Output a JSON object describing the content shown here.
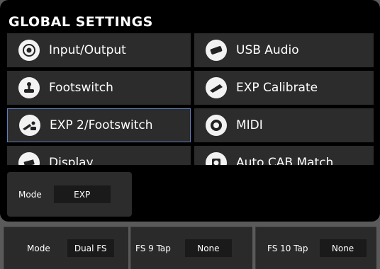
{
  "header": {
    "title": "GLOBAL SETTINGS"
  },
  "menu": {
    "items": [
      {
        "label": "Input/Output",
        "icon": "input-output-icon",
        "active": false
      },
      {
        "label": "USB Audio",
        "icon": "usb-audio-icon",
        "active": false
      },
      {
        "label": "Footswitch",
        "icon": "footswitch-icon",
        "active": false
      },
      {
        "label": "EXP Calibrate",
        "icon": "exp-calibrate-icon",
        "active": false
      },
      {
        "label": "EXP 2/Footswitch",
        "icon": "exp2-footswitch-icon",
        "active": true
      },
      {
        "label": "MIDI",
        "icon": "midi-icon",
        "active": false
      },
      {
        "label": "Display",
        "icon": "display-icon",
        "active": false
      },
      {
        "label": "Auto CAB Match",
        "icon": "auto-cab-icon",
        "active": false
      }
    ]
  },
  "sub": {
    "mode_label": "Mode",
    "mode_value": "EXP"
  },
  "bottom": {
    "cells": [
      {
        "label": "Mode",
        "value": "Dual FS"
      },
      {
        "label": "FS 9 Tap",
        "value": "None"
      },
      {
        "label": "FS 10 Tap",
        "value": "None"
      }
    ]
  },
  "colors": {
    "panel": "#000000",
    "tile": "#2c2c2c",
    "active_border": "#5f7fbf",
    "background": "#5a5a5a"
  }
}
